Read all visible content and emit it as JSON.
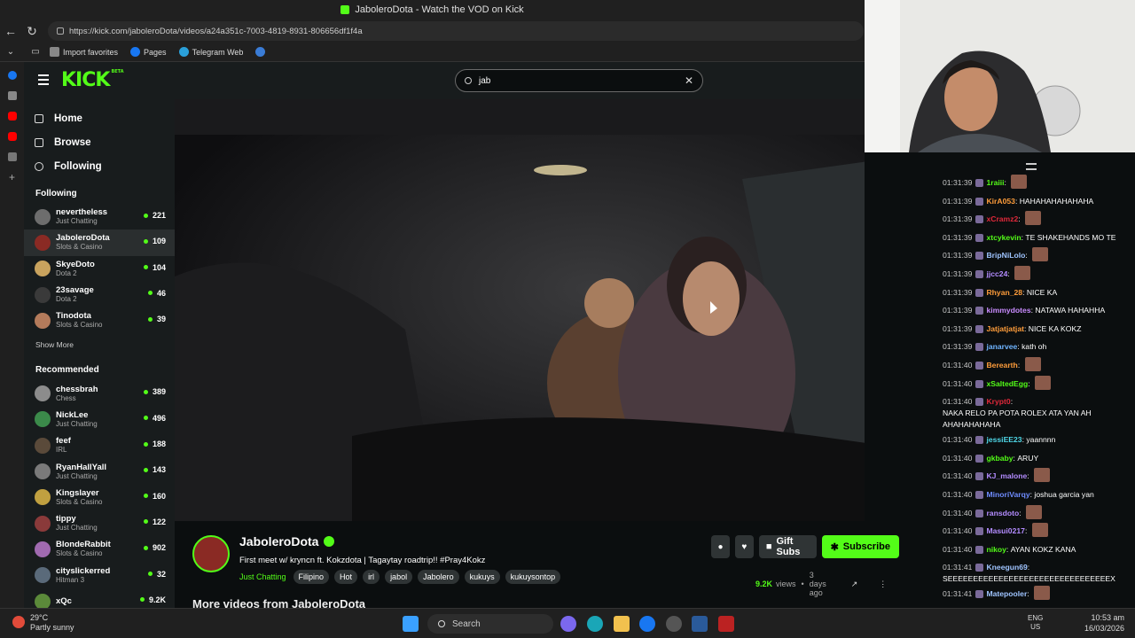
{
  "browser": {
    "title": "JaboleroDota - Watch the VOD on Kick",
    "url": "https://kick.com/jaboleroDota/videos/a24a351c-7003-4819-8931-806656df1f4a",
    "favorites": [
      "Import favorites",
      "Pages",
      "Telegram Web"
    ]
  },
  "kick": {
    "logo": "KICK",
    "beta": "BETA",
    "search_value": "jab",
    "nav": [
      "Home",
      "Browse",
      "Following"
    ],
    "following_heading": "Following",
    "following": [
      {
        "name": "nevertheless",
        "game": "Just Chatting",
        "viewers": "221"
      },
      {
        "name": "JaboleroDota",
        "game": "Slots & Casino",
        "viewers": "109"
      },
      {
        "name": "SkyeDoto",
        "game": "Dota 2",
        "viewers": "104"
      },
      {
        "name": "23savage",
        "game": "Dota 2",
        "viewers": "46"
      },
      {
        "name": "Tinodota",
        "game": "Slots & Casino",
        "viewers": "39"
      }
    ],
    "show_more": "Show More",
    "recommended_heading": "Recommended",
    "recommended": [
      {
        "name": "chessbrah",
        "game": "Chess",
        "viewers": "389"
      },
      {
        "name": "NickLee",
        "game": "Just Chatting",
        "viewers": "496"
      },
      {
        "name": "feef",
        "game": "IRL",
        "viewers": "188"
      },
      {
        "name": "RyanHallYall",
        "game": "Just Chatting",
        "viewers": "143"
      },
      {
        "name": "Kingslayer",
        "game": "Slots & Casino",
        "viewers": "160"
      },
      {
        "name": "tippy",
        "game": "Just Chatting",
        "viewers": "122"
      },
      {
        "name": "BlondeRabbit",
        "game": "Slots & Casino",
        "viewers": "902"
      },
      {
        "name": "cityslickerred",
        "game": "Hitman 3",
        "viewers": "32"
      },
      {
        "name": "xQc",
        "game": "",
        "viewers": "9.2K"
      }
    ],
    "channel": {
      "name": "JaboleroDota",
      "title": "First meet w/ kryncn ft. Kokzdota | Tagaytay roadtrip!! #Pray4Kokz",
      "category": "Just Chatting",
      "tags": [
        "Filipino",
        "Hot",
        "irl",
        "jabol",
        "Jabolero",
        "kukuys",
        "kukuysontop"
      ],
      "views": "9.2K",
      "views_label": "views",
      "age": "3 days ago",
      "gift_label": "Gift Subs",
      "subscribe_label": "Subscribe"
    },
    "more_videos": "More videos from JaboleroDota"
  },
  "chat": [
    {
      "t": "01:31:39",
      "u": "1raiii",
      "c": "#53fc18",
      "m": "",
      "e": true
    },
    {
      "t": "01:31:39",
      "u": "KirA053",
      "c": "#ff9d3b",
      "m": "HAHAHAHAHAHAHA",
      "e": false
    },
    {
      "t": "01:31:39",
      "u": "xCramz2",
      "c": "#e0283a",
      "m": "",
      "e": true
    },
    {
      "t": "01:31:39",
      "u": "xtcykevin",
      "c": "#53fc18",
      "m": "TE SHAKEHANDS MO TE",
      "e": false
    },
    {
      "t": "01:31:39",
      "u": "BripNiLolo",
      "c": "#9fc4ff",
      "m": "",
      "e": true
    },
    {
      "t": "01:31:39",
      "u": "jjcc24",
      "c": "#b38cff",
      "m": "",
      "e": true
    },
    {
      "t": "01:31:39",
      "u": "Rhyan_28",
      "c": "#ff9d3b",
      "m": "NICE KA",
      "e": false
    },
    {
      "t": "01:31:39",
      "u": "kimmydotes",
      "c": "#c98cff",
      "m": "NATAWA HAHAHHA",
      "e": false
    },
    {
      "t": "01:31:39",
      "u": "Jatjatjatjat",
      "c": "#ff9d3b",
      "m": "NICE KA KOKZ",
      "e": false
    },
    {
      "t": "01:31:39",
      "u": "janarvee",
      "c": "#6fb4ff",
      "m": "kath oh",
      "e": false
    },
    {
      "t": "01:31:40",
      "u": "Berearth",
      "c": "#ff9d3b",
      "m": "",
      "e": true
    },
    {
      "t": "01:31:40",
      "u": "xSaltedEgg",
      "c": "#53fc18",
      "m": "",
      "e": true
    },
    {
      "t": "01:31:40",
      "u": "Krypt0",
      "c": "#e0283a",
      "m": "NAKA RELO PA POTA ROLEX ATA YAN AH AHAHAHAHAHA",
      "e": false
    },
    {
      "t": "01:31:40",
      "u": "jessiEE23",
      "c": "#4fd8e8",
      "m": "yaannnn",
      "e": false
    },
    {
      "t": "01:31:40",
      "u": "gkbaby",
      "c": "#53fc18",
      "m": "ARUY",
      "e": false
    },
    {
      "t": "01:31:40",
      "u": "KJ_malone",
      "c": "#b38cff",
      "m": "",
      "e": true
    },
    {
      "t": "01:31:40",
      "u": "MinoriVarqy",
      "c": "#6f8cff",
      "m": "joshua garcia yan",
      "e": false
    },
    {
      "t": "01:31:40",
      "u": "ransdoto",
      "c": "#b38cff",
      "m": "",
      "e": true
    },
    {
      "t": "01:31:40",
      "u": "Masui0217",
      "c": "#b38cff",
      "m": "",
      "e": true
    },
    {
      "t": "01:31:40",
      "u": "nikoy",
      "c": "#53fc18",
      "m": "AYAN KOKZ KANA",
      "e": false
    },
    {
      "t": "01:31:41",
      "u": "Kneegun69",
      "c": "#9fc4ff",
      "m": "SEEEEEEEEEEEEEEEEEEEEEEEEEEEEEEEEX",
      "e": false
    },
    {
      "t": "01:31:41",
      "u": "Matepooler",
      "c": "#9fc4ff",
      "m": "",
      "e": true
    }
  ],
  "taskbar": {
    "temp": "29°C",
    "weather": "Partly sunny",
    "search": "Search",
    "lang1": "ENG",
    "lang2": "US",
    "time": "10:53 am",
    "date": "16/03/2026"
  }
}
